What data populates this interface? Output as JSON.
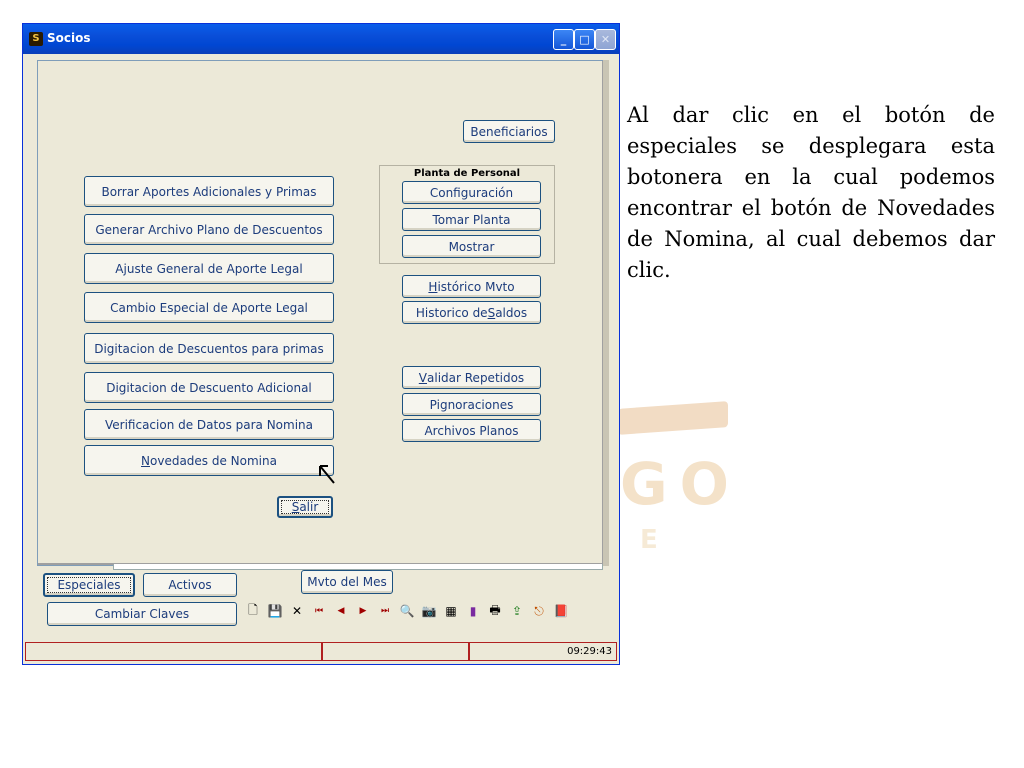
{
  "window": {
    "title": "Socios",
    "app_icon_glyph": "S",
    "title_buttons": {
      "minimize": "_",
      "maximize": "□",
      "close": "✕"
    }
  },
  "main": {
    "left_buttons": [
      "Borrar Aportes Adicionales y Primas",
      "Generar Archivo Plano de Descuentos",
      "Ajuste General de Aporte Legal",
      "Cambio Especial de Aporte Legal",
      "Digitacion de Descuentos para primas",
      "Digitacion de Descuento Adicional",
      "Verificacion de Datos para Nomina"
    ],
    "novedades": {
      "underline": "N",
      "rest": "ovedades de Nomina"
    },
    "beneficiarios": "Beneficiarios",
    "planta_group": {
      "label": "Planta de Personal",
      "configuracion": "Configuración",
      "tomar_planta": "Tomar Planta",
      "mostrar": "Mostrar"
    },
    "historico_mvto": {
      "underline": "H",
      "rest": "istórico Mvto"
    },
    "historico_saldos": {
      "pre": "Historico de ",
      "underline": "S",
      "rest": "aldos"
    },
    "validar_repetidos": {
      "underline": "V",
      "rest": "alidar Repetidos"
    },
    "pignoraciones": "Pignoraciones",
    "archivos_planos": "Archivos Planos",
    "salir": {
      "underline": "S",
      "rest": "alir"
    }
  },
  "bottom": {
    "especiales": "Especiales",
    "activos": "Activos",
    "mvto_del_mes": "Mvto del Mes",
    "cambiar_claves": "Cambiar Claves"
  },
  "toolbar": [
    {
      "name": "new-icon",
      "glyph": "🗋"
    },
    {
      "name": "save-icon",
      "glyph": "💾"
    },
    {
      "name": "delete-icon",
      "glyph": "✕"
    },
    {
      "name": "first-record-icon",
      "glyph": "⏮"
    },
    {
      "name": "previous-record-icon",
      "glyph": "◀"
    },
    {
      "name": "next-record-icon",
      "glyph": "▶"
    },
    {
      "name": "last-record-icon",
      "glyph": "⏭"
    },
    {
      "name": "binoculars-icon",
      "glyph": "🔍"
    },
    {
      "name": "camera-icon",
      "glyph": "📷"
    },
    {
      "name": "grid-icon",
      "glyph": "▦"
    },
    {
      "name": "chart-icon",
      "glyph": "▮"
    },
    {
      "name": "print-icon",
      "glyph": "🖶"
    },
    {
      "name": "export-icon",
      "glyph": "⇪"
    },
    {
      "name": "exit-door-icon",
      "glyph": "⎋"
    },
    {
      "name": "close-book-icon",
      "glyph": "📕"
    }
  ],
  "status": {
    "time": "09:29:43"
  },
  "description": "Al dar clic en el botón de especiales se desplegara esta botonera en la cual podemos encontrar el botón de Novedades de Nomina, al cual debemos dar clic.",
  "watermark": {
    "text": "GO",
    "sub": "E"
  }
}
